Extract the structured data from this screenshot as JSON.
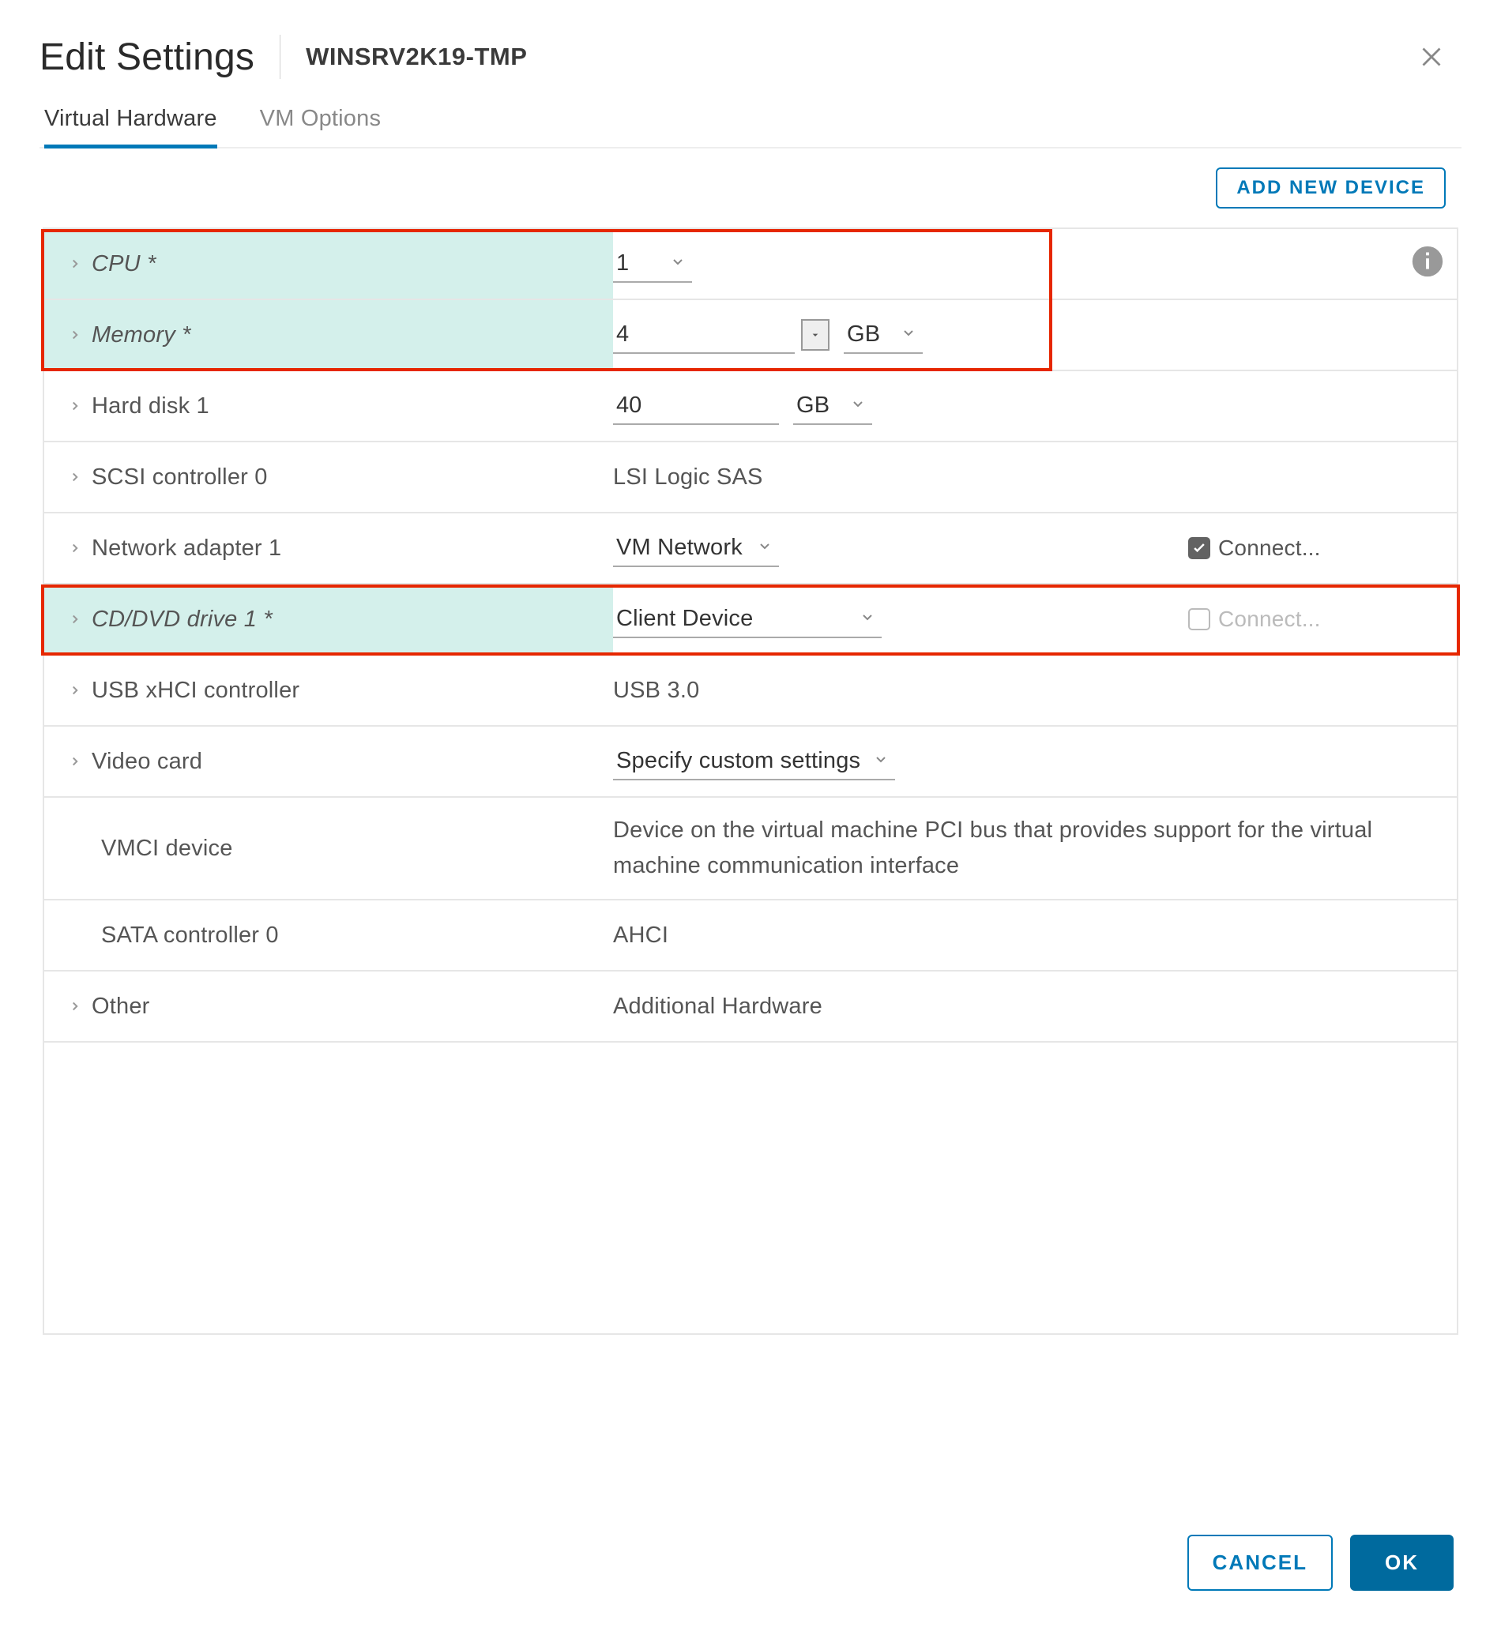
{
  "header": {
    "title": "Edit Settings",
    "vm_name": "WINSRV2K19-TMP"
  },
  "tabs": {
    "virtual_hardware": "Virtual Hardware",
    "vm_options": "VM Options"
  },
  "actions": {
    "add_device": "ADD NEW DEVICE"
  },
  "rows": {
    "cpu": {
      "label": "CPU *",
      "value": "1"
    },
    "memory": {
      "label": "Memory *",
      "value": "4",
      "unit": "GB"
    },
    "hdd1": {
      "label": "Hard disk 1",
      "value": "40",
      "unit": "GB"
    },
    "scsi0": {
      "label": "SCSI controller 0",
      "value": "LSI Logic SAS"
    },
    "net1": {
      "label": "Network adapter 1",
      "value": "VM Network",
      "connect_label": "Connect..."
    },
    "cddvd1": {
      "label": "CD/DVD drive 1 *",
      "value": "Client Device",
      "connect_label": "Connect..."
    },
    "usb": {
      "label": "USB xHCI controller",
      "value": "USB 3.0"
    },
    "video": {
      "label": "Video card",
      "value": "Specify custom settings"
    },
    "vmci": {
      "label": "VMCI device",
      "value": "Device on the virtual machine PCI bus that provides support for the virtual machine communication interface"
    },
    "sata0": {
      "label": "SATA controller 0",
      "value": "AHCI"
    },
    "other": {
      "label": "Other",
      "value": "Additional Hardware"
    }
  },
  "footer": {
    "cancel": "CANCEL",
    "ok": "OK"
  }
}
